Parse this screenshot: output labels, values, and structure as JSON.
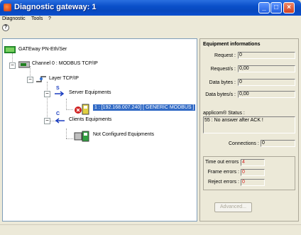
{
  "window": {
    "title": "Diagnostic gateway: 1"
  },
  "menu": {
    "items": [
      "Diagnostic",
      "Tools",
      "?"
    ]
  },
  "tree": {
    "gateway": "GATEway PN-Eth/Ser",
    "channel": "Channel 0 : MODBUS TCP/IP",
    "layer": "Layer TCP/IP",
    "server_equipments": "Server Equipments",
    "server_item": "1 : [192.168.007.240] [ GENERIC MODBUS ]",
    "clients_equipments": "Clients Equipments",
    "not_configured": "Not Configured Equipments",
    "server_letter": "S",
    "client_letter": "C"
  },
  "equipment": {
    "title": "Equipment informations",
    "request_label": "Request :",
    "request_value": "0",
    "request_s_label": "Request/s :",
    "request_s_value": "0,00",
    "data_bytes_label": "Data bytes :",
    "data_bytes_value": "0",
    "data_bytes_s_label": "Data bytes/s :",
    "data_bytes_s_value": "0,00",
    "status_label": "applicom® Status :",
    "status_value": "55 : No answer after ACK !",
    "connections_label": "Connections :",
    "connections_value": "0",
    "timeout_label": "Time out errors :",
    "timeout_value": "4",
    "frame_label": "Frame errors :",
    "frame_value": "0",
    "reject_label": "Reject errors :",
    "reject_value": "0",
    "advanced_label": "Advanced..."
  }
}
